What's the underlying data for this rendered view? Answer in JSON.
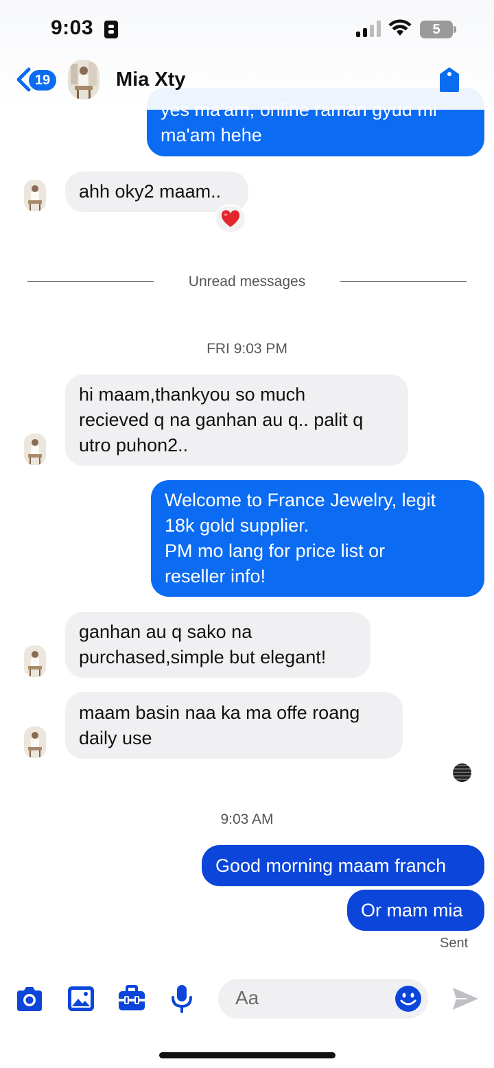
{
  "status_bar": {
    "time": "9:03",
    "battery": "5"
  },
  "header": {
    "unread_count": "19",
    "contact_name": "Mia Xty"
  },
  "messages": [
    {
      "lines": [
        "yes ma'am, online raman gyud mi",
        "ma'am hehe"
      ]
    },
    {
      "lines": [
        "ahh oky2 maam.."
      ],
      "reaction": "❤️"
    },
    {
      "lines": [
        "hi maam,thankyou so much",
        "recieved q na ganhan au q.. palit q",
        "utro puhon2.."
      ]
    },
    {
      "lines": [
        "Welcome to France Jewelry, legit",
        "18k gold supplier.",
        "PM mo lang for price list or",
        "reseller info!"
      ]
    },
    {
      "lines": [
        "ganhan au q sako na",
        "purchased,simple but elegant!"
      ]
    },
    {
      "lines": [
        "maam basin naa ka ma offe roang",
        "daily use"
      ]
    },
    {
      "lines": [
        "Good morning maam franch"
      ]
    },
    {
      "lines": [
        "Or mam mia"
      ]
    }
  ],
  "unread_divider": "Unread messages",
  "timestamps": [
    "FRI 9:03 PM",
    "9:03 AM"
  ],
  "sent_status": "Sent",
  "composer": {
    "placeholder": "Aa"
  },
  "colors": {
    "outgoing_bubble": "#0b6bf2",
    "outgoing_bubble_recent": "#0b45d9",
    "incoming_bubble": "#f0f0f2",
    "accent": "#0a6cf0"
  },
  "icons": [
    "back-chevron-icon",
    "tag-icon",
    "camera-icon",
    "image-icon",
    "toolbox-icon",
    "microphone-icon",
    "emoji-icon",
    "send-icon"
  ]
}
